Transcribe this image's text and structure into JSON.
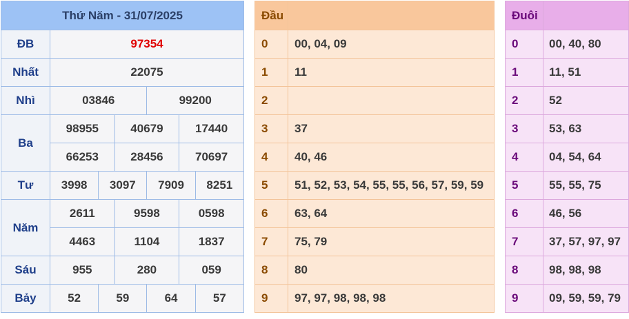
{
  "title": "Thứ Năm - 31/07/2025",
  "prizes": {
    "db": {
      "label": "ĐB",
      "values": [
        "97354"
      ]
    },
    "nhat": {
      "label": "Nhất",
      "values": [
        "22075"
      ]
    },
    "nhi": {
      "label": "Nhì",
      "values": [
        "03846",
        "99200"
      ]
    },
    "ba": {
      "label": "Ba",
      "values": [
        "98955",
        "40679",
        "17440",
        "66253",
        "28456",
        "70697"
      ]
    },
    "tu": {
      "label": "Tư",
      "values": [
        "3998",
        "3097",
        "7909",
        "8251"
      ]
    },
    "nam": {
      "label": "Năm",
      "values": [
        "2611",
        "9598",
        "0598",
        "4463",
        "1104",
        "1837"
      ]
    },
    "sau": {
      "label": "Sáu",
      "values": [
        "955",
        "280",
        "059"
      ]
    },
    "bay": {
      "label": "Bảy",
      "values": [
        "52",
        "59",
        "64",
        "57"
      ]
    }
  },
  "heads": {
    "header": "Đầu",
    "rows": [
      {
        "key": "0",
        "value": "00, 04, 09"
      },
      {
        "key": "1",
        "value": "11"
      },
      {
        "key": "2",
        "value": ""
      },
      {
        "key": "3",
        "value": "37"
      },
      {
        "key": "4",
        "value": "40, 46"
      },
      {
        "key": "5",
        "value": "51, 52, 53, 54, 55, 55, 56, 57, 59, 59"
      },
      {
        "key": "6",
        "value": "63, 64"
      },
      {
        "key": "7",
        "value": "75, 79"
      },
      {
        "key": "8",
        "value": "80"
      },
      {
        "key": "9",
        "value": "97, 97, 98, 98, 98"
      }
    ]
  },
  "tails": {
    "header": "Đuôi",
    "rows": [
      {
        "key": "0",
        "value": "00, 40, 80"
      },
      {
        "key": "1",
        "value": "11, 51"
      },
      {
        "key": "2",
        "value": "52"
      },
      {
        "key": "3",
        "value": "53, 63"
      },
      {
        "key": "4",
        "value": "04, 54, 64"
      },
      {
        "key": "5",
        "value": "55, 55, 75"
      },
      {
        "key": "6",
        "value": "46, 56"
      },
      {
        "key": "7",
        "value": "37, 57, 97, 97"
      },
      {
        "key": "8",
        "value": "98, 98, 98"
      },
      {
        "key": "9",
        "value": "09, 59, 59, 79"
      }
    ]
  },
  "colors": {
    "prize_header_bg": "#9dc2f5",
    "special_prize": "#e00000",
    "heads_bg": "#fde8d6",
    "tails_bg": "#f7e3f7"
  }
}
